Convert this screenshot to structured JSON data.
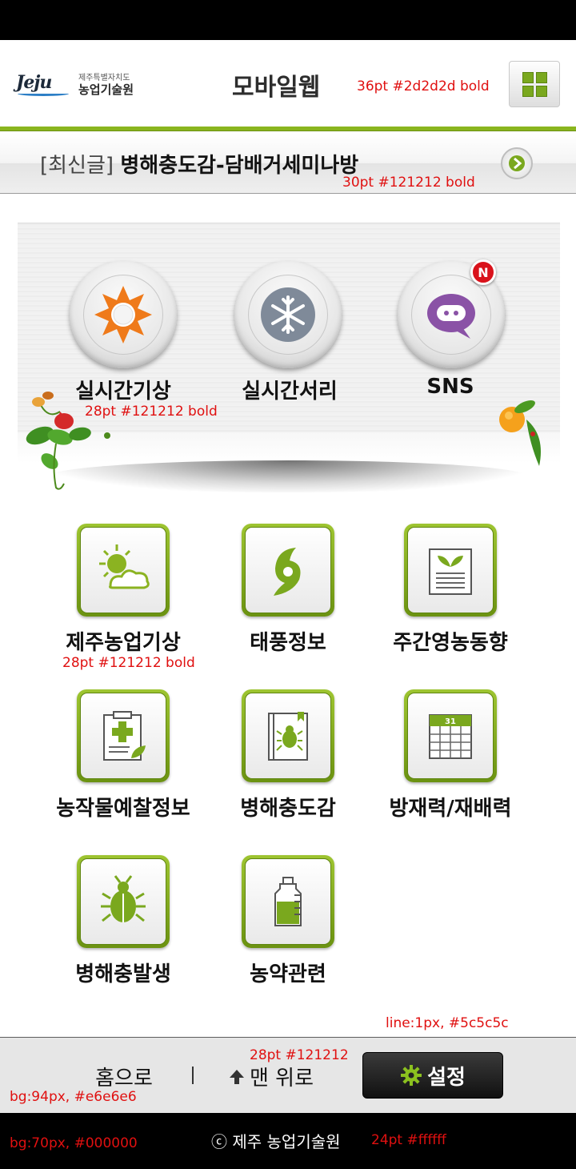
{
  "header": {
    "logo_mark": "Jeju",
    "logo_line1": "제주특별자치도",
    "logo_line2": "농업기술원",
    "title": "모바일웹",
    "title_spec": "36pt  #2d2d2d  bold"
  },
  "latest": {
    "prefix": "[최신글]",
    "headline": "병해충도감-담배거세미나방",
    "spec": "30pt  #121212  bold"
  },
  "quick": {
    "items": [
      {
        "label": "실시간기상",
        "icon": "sun-icon"
      },
      {
        "label": "실시간서리",
        "icon": "snowflake-icon"
      },
      {
        "label": "SNS",
        "icon": "chat-bubble-icon",
        "badge": "N"
      }
    ],
    "spec": "28pt  #121212  bold"
  },
  "menu": {
    "items": [
      {
        "label": "제주농업기상",
        "icon": "sun-cloud-icon"
      },
      {
        "label": "태풍정보",
        "icon": "typhoon-icon"
      },
      {
        "label": "주간영농동향",
        "icon": "sprout-document-icon"
      },
      {
        "label": "농작물예찰정보",
        "icon": "clipboard-cross-icon"
      },
      {
        "label": "병해충도감",
        "icon": "bug-book-icon"
      },
      {
        "label": "방재력/재배력",
        "icon": "calendar-icon"
      },
      {
        "label": "병해충발생",
        "icon": "beetle-icon"
      },
      {
        "label": "농약관련",
        "icon": "pesticide-bottle-icon"
      }
    ],
    "spec": "28pt  #121212  bold"
  },
  "bottom": {
    "home_label": "홈으로",
    "top_label": "맨 위로",
    "settings_label": "설정",
    "line_spec": "line:1px,  #5c5c5c",
    "label_spec": "28pt  #121212",
    "bg_spec": "bg:94px,  #e6e6e6"
  },
  "footer": {
    "copyright": "ⓒ 제주 농업기술원",
    "spec": "24pt  #ffffff",
    "bg_spec": "bg:70px,  #000000"
  },
  "colors": {
    "accent": "#8ab51e",
    "text": "#121212",
    "title": "#2d2d2d",
    "bottom_bg": "#e6e6e6",
    "footer_bg": "#000000",
    "line": "#5c5c5c"
  }
}
